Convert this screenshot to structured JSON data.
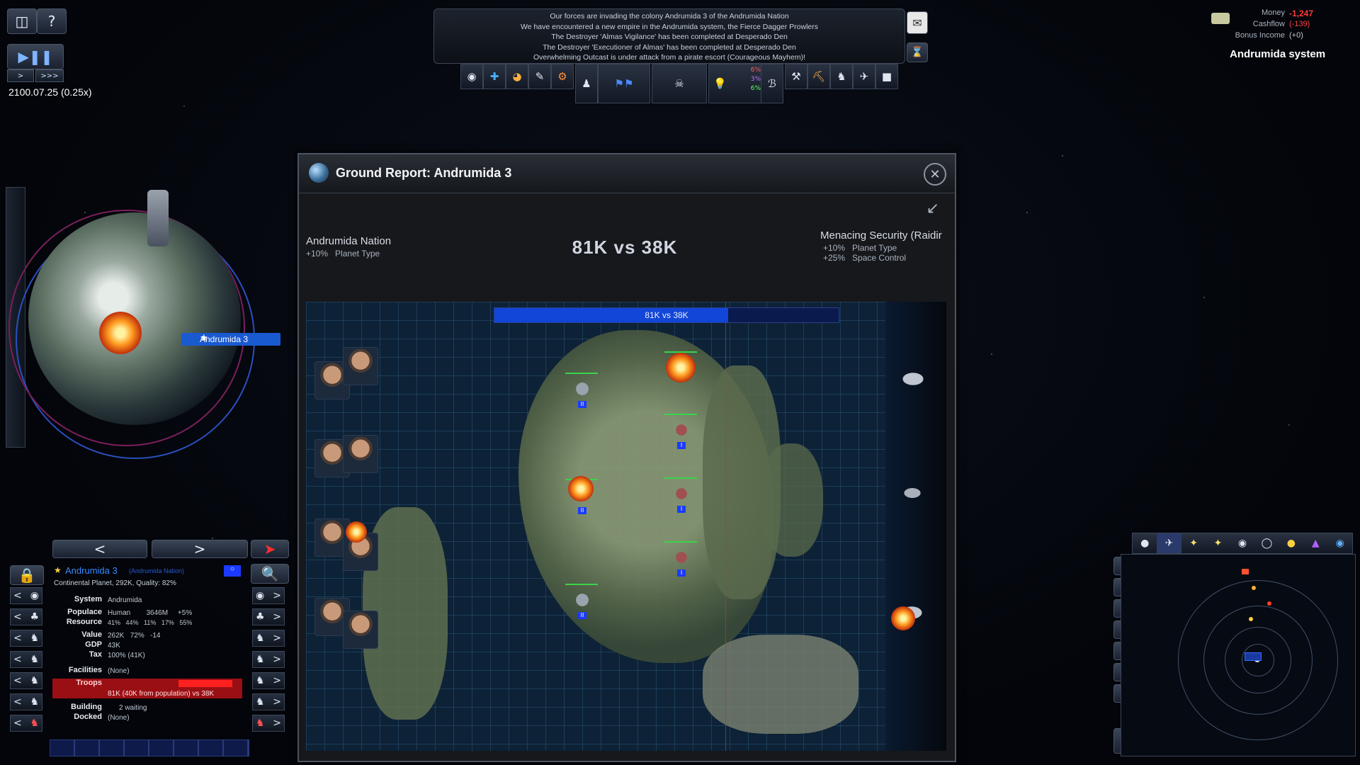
{
  "top_left": {
    "date": "2100.07.25",
    "speed": "(0.25x)",
    "speed_buttons": [
      ">",
      ">>>"
    ]
  },
  "messages": [
    "Our forces are invading the colony Andrumida 3 of the Andrumida Nation",
    "We have encountered a new empire in the Andrumida system, the Fierce Dagger Prowlers",
    "The Destroyer 'Almas Vigilance' has been completed at Desperado Den",
    "The Destroyer 'Executioner of Almas' has been completed at Desperado Den",
    "Overwhelming Outcast is under attack from a pirate escort (Courageous Mayhem)!"
  ],
  "finance": {
    "money_label": "Money",
    "money_value": "-1,247",
    "cashflow_label": "Cashflow",
    "cashflow_value": "(-139)",
    "bonus_label": "Bonus Income",
    "bonus_value": "(+0)",
    "money_color": "#ff3a3a"
  },
  "system_name": "Andrumida system",
  "toolbar": {
    "stats": [
      "6%",
      "3%",
      "6%"
    ]
  },
  "planet_tag": "Andrumida 3",
  "ground_report": {
    "title": "Ground Report: Andrumida 3",
    "attacker_name": "Andrumida Nation",
    "attacker_mods": [
      {
        "value": "+10%",
        "label": "Planet Type"
      }
    ],
    "defender_name": "Menacing Security (Raidir",
    "defender_mods": [
      {
        "value": "+10%",
        "label": "Planet Type"
      },
      {
        "value": "+25%",
        "label": "Space Control"
      }
    ],
    "versus": "81K vs 38K",
    "bar_text": "81K vs 38K",
    "bar_fill_fraction": 0.68
  },
  "planet_info": {
    "name": "Andrumida 3",
    "owner": "(Andrumida Nation)",
    "description": "Continental Planet, 292K, Quality: 82%",
    "rows": [
      {
        "label": "System",
        "value": "Andrumida"
      },
      {
        "label": "Populace",
        "value": "Human        3646M     +5%"
      },
      {
        "label": "Resource",
        "value": "41%   44%   11%   17%   55%"
      },
      {
        "label": "Value",
        "value": "262K   72%   -14"
      },
      {
        "label": "GDP",
        "value": "43K"
      },
      {
        "label": "Tax",
        "value": "100% (41K)"
      },
      {
        "label": "Facilities",
        "value": "(None)"
      },
      {
        "label": "Troops",
        "value": "81K (40K from population)  vs  38K"
      },
      {
        "label": "Building",
        "value": "2 waiting"
      },
      {
        "label": "Docked",
        "value": "(None)"
      }
    ]
  },
  "nav": {
    "prev": "<",
    "next": ">"
  }
}
